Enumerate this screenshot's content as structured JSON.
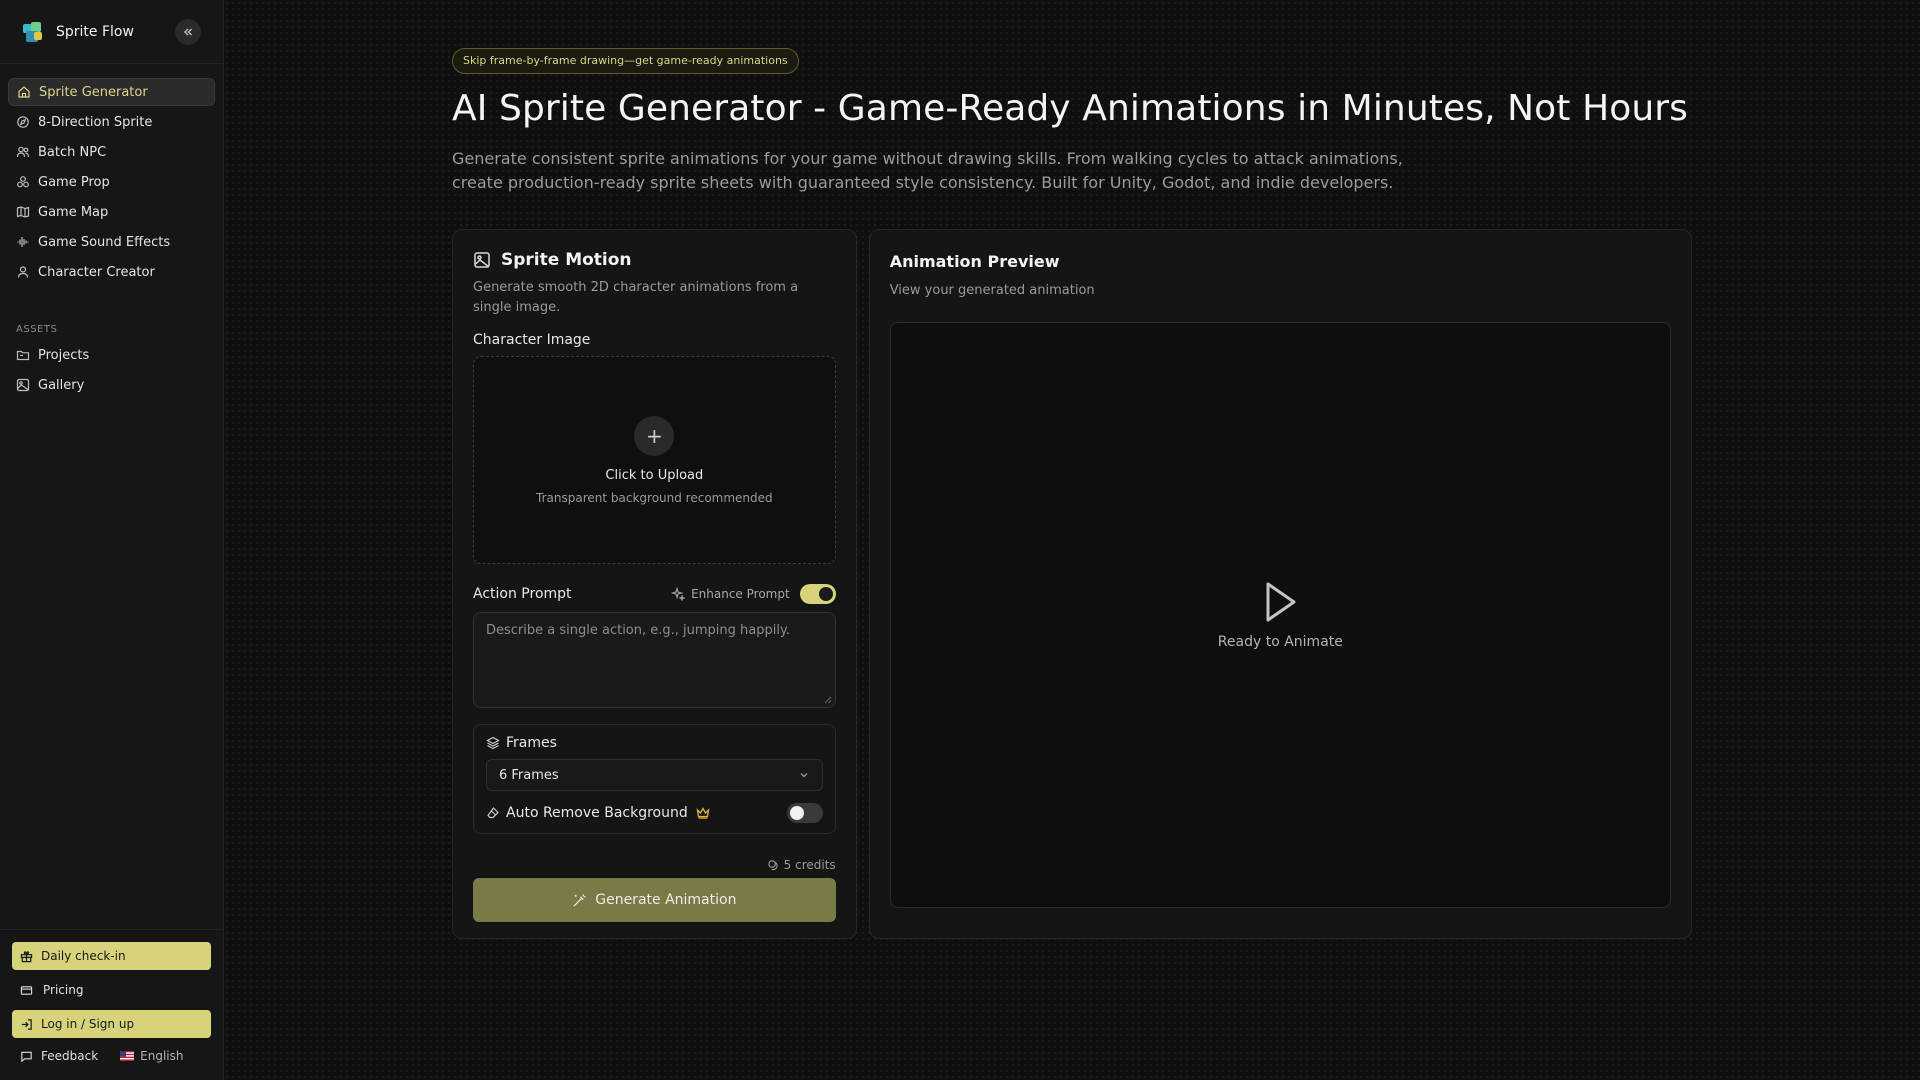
{
  "brand": {
    "name": "Sprite Flow"
  },
  "nav": {
    "items": [
      {
        "label": "Sprite Generator",
        "icon": "home-icon"
      },
      {
        "label": "8-Direction Sprite",
        "icon": "compass-icon"
      },
      {
        "label": "Batch NPC",
        "icon": "users-icon"
      },
      {
        "label": "Game Prop",
        "icon": "shapes-icon"
      },
      {
        "label": "Game Map",
        "icon": "map-icon"
      },
      {
        "label": "Game Sound Effects",
        "icon": "audio-wave-icon"
      },
      {
        "label": "Character Creator",
        "icon": "user-icon"
      }
    ],
    "section_label": "ASSETS",
    "assets": [
      {
        "label": "Projects",
        "icon": "folder-icon"
      },
      {
        "label": "Gallery",
        "icon": "image-icon"
      }
    ]
  },
  "sidebar_bottom": {
    "checkin": "Daily check-in",
    "pricing": "Pricing",
    "login": "Log in / Sign up",
    "feedback": "Feedback",
    "language": "English"
  },
  "hero": {
    "pill": "Skip frame-by-frame drawing—get game-ready animations",
    "title": "AI Sprite Generator - Game-Ready Animations in Minutes, Not Hours",
    "subtitle": "Generate consistent sprite animations for your game without drawing skills. From walking cycles to attack animations, create production-ready sprite sheets with guaranteed style consistency. Built for Unity, Godot, and indie developers."
  },
  "motion": {
    "title": "Sprite Motion",
    "desc": "Generate smooth 2D character animations from a single image.",
    "image_label": "Character Image",
    "upload_title": "Click to Upload",
    "upload_sub": "Transparent background recommended",
    "prompt_label": "Action Prompt",
    "enhance_label": "Enhance Prompt",
    "enhance_on": true,
    "prompt_placeholder": "Describe a single action, e.g., jumping happily.",
    "frames_label": "Frames",
    "frames_value": "6 Frames",
    "remove_bg_label": "Auto Remove Background",
    "remove_bg_on": false,
    "credits": "5 credits",
    "generate_label": "Generate Animation"
  },
  "preview": {
    "title": "Animation Preview",
    "desc": "View your generated animation",
    "status": "Ready to Animate"
  },
  "colors": {
    "accent": "#d6d37a",
    "generate_button": "#7a7a46",
    "crown": "#e4b13a"
  }
}
